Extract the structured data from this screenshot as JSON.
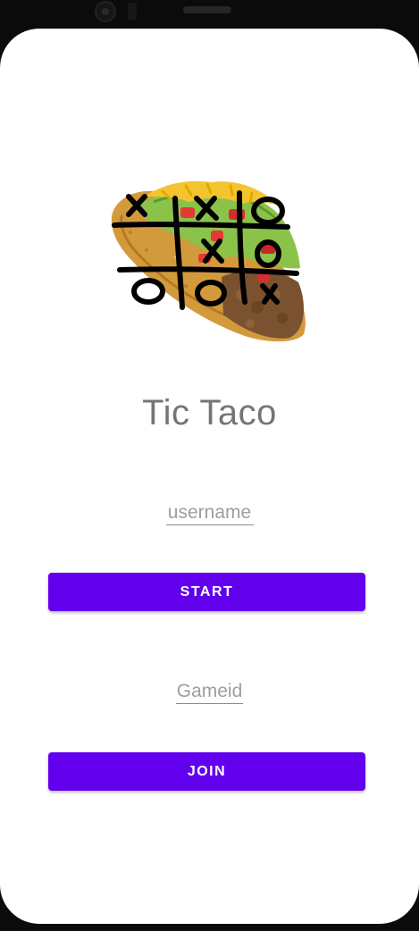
{
  "app": {
    "title": "Tic Taco"
  },
  "form": {
    "username_placeholder": "username",
    "username_value": "",
    "start_label": "START",
    "gameid_placeholder": "Gameid",
    "gameid_value": "",
    "join_label": "JOIN"
  },
  "colors": {
    "accent": "#6200ee",
    "title": "#757575",
    "screen_background": "#ffffff",
    "device_frame": "#0b0b0b"
  },
  "icons": {
    "logo": "taco-tic-tac-toe-logo"
  }
}
